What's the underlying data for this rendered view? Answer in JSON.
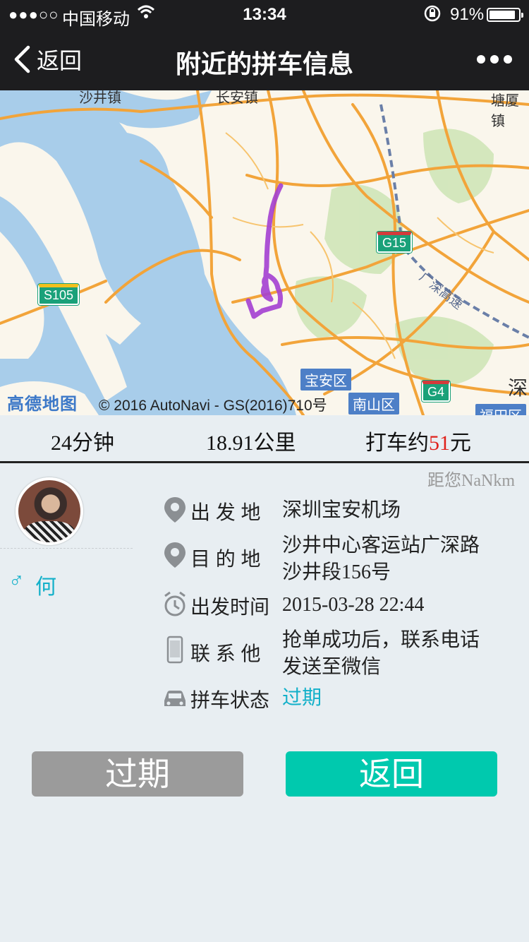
{
  "status_bar": {
    "signal": "●●●○○",
    "carrier": "中国移动",
    "time": "13:34",
    "battery_percent": "91%",
    "battery_level": 0.91
  },
  "nav": {
    "back_label": "返回",
    "title": "附近的拼车信息"
  },
  "map": {
    "logo": "高德地图",
    "copyright": "© 2016 AutoNavi - GS(2016)710号",
    "labels": {
      "top_left": "沙井镇",
      "top_center": "长安镇",
      "top_right": "塘厦镇",
      "right_edge": "深",
      "highway_g15": "G15",
      "highway_s105": "S105",
      "highway_g4": "G4",
      "district_baoan": "宝安区",
      "district_nanshan": "南山区",
      "district_futian": "福田区",
      "railway": "广深高速"
    },
    "colors": {
      "water": "#a8cdea",
      "land": "#faf6ec",
      "road": "#f2a43a",
      "route": "#a33fd1"
    }
  },
  "stats": {
    "duration": "24分钟",
    "distance": "18.91公里",
    "price_prefix": "打车约",
    "price_value": "51",
    "price_suffix": "元"
  },
  "distance_to_you": "距您NaNkm",
  "rider": {
    "gender_symbol": "♂",
    "name": "何"
  },
  "details": {
    "origin_label": "出 发 地",
    "origin": "深圳宝安机场",
    "destination_label": "目 的 地",
    "destination": "沙井中心客运站广深路沙井段156号",
    "time_label": "出发时间",
    "time": "2015-03-28 22:44",
    "contact_label": "联 系 他",
    "contact": "抢单成功后，联系电话发送至微信",
    "status_label": "拼车状态",
    "status": "过期"
  },
  "buttons": {
    "expired": "过期",
    "back": "返回"
  }
}
